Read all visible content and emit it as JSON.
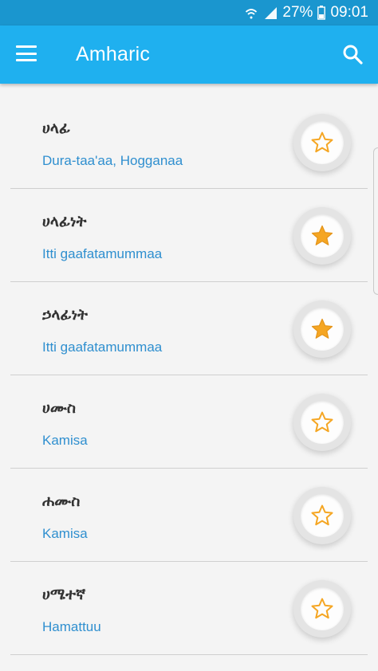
{
  "status_bar": {
    "battery": "27%",
    "time": "09:01"
  },
  "app_bar": {
    "title": "Amharic",
    "menu_icon": "menu-icon",
    "search_icon": "search-icon"
  },
  "colors": {
    "app_bar": "#1fb0ef",
    "status_bar": "#1a96cf",
    "meaning_text": "#2f8fcf",
    "star_gold": "#f5a623"
  },
  "entries": [
    {
      "word": "ሀላፊ",
      "meaning": "Dura-taa'aa, Hogganaa",
      "favorite": false
    },
    {
      "word": "ሀላፊነት",
      "meaning": "Itti gaafatamummaa",
      "favorite": true
    },
    {
      "word": "ኃላፊነት",
      "meaning": "Itti gaafatamummaa",
      "favorite": true
    },
    {
      "word": "ሀሙስ",
      "meaning": "Kamisa",
      "favorite": false
    },
    {
      "word": "ሐሙስ",
      "meaning": "Kamisa",
      "favorite": false
    },
    {
      "word": "ሀሜተኛ",
      "meaning": "Hamattuu",
      "favorite": false
    }
  ]
}
